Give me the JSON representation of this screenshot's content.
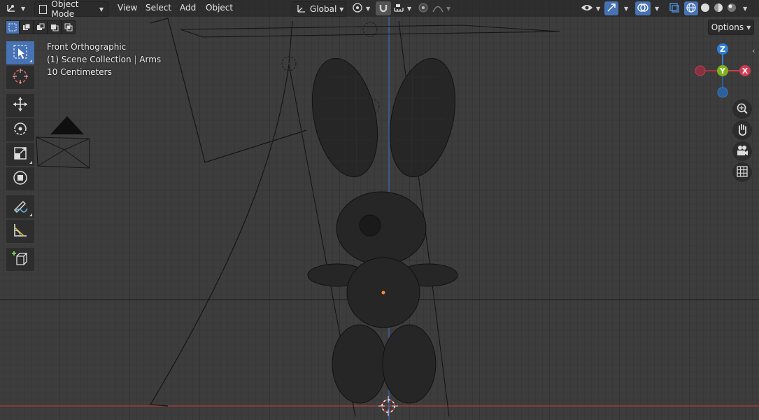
{
  "header": {
    "mode_label": "Object Mode",
    "menus": [
      "View",
      "Select",
      "Add",
      "Object"
    ],
    "transform_orientation": "Global"
  },
  "viewport_overlay": {
    "view_name": "Front Orthographic",
    "collection_line_prefix": "(1) Scene Collection",
    "active_object": "Arms",
    "grid_scale": "10 Centimeters"
  },
  "options_label": "Options",
  "gizmo": {
    "z": "Z",
    "y": "Y",
    "x": "X"
  },
  "colors": {
    "accent": "#4772b3",
    "axis_x": "#d03c4f",
    "axis_y": "#7fb21a",
    "axis_z": "#2f7fd8",
    "viewport_bg": "#3d3d3d"
  },
  "icons": {
    "toolbar": [
      "select-box-icon",
      "cursor-icon",
      "move-icon",
      "rotate-icon",
      "scale-icon",
      "transform-icon",
      "annotate-icon",
      "measure-icon",
      "add-cube-icon"
    ],
    "navigation": [
      "zoom-icon",
      "hand-pan-icon",
      "camera-icon",
      "grid-icon"
    ]
  }
}
